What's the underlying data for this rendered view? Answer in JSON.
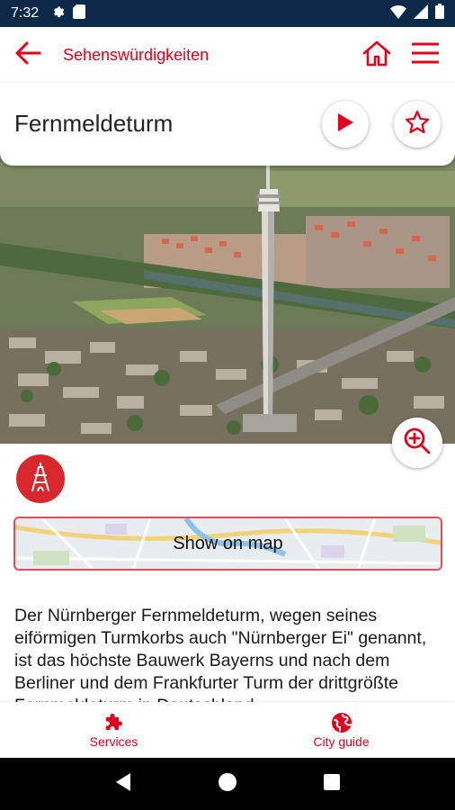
{
  "status_bar": {
    "time": "7:32",
    "left_icons": [
      "gear-icon",
      "sim-card-icon"
    ],
    "right_icons": [
      "wifi-icon",
      "signal-icon",
      "battery-icon"
    ]
  },
  "app_bar": {
    "title": "Sehenswürdigkeiten",
    "back_icon": "arrow-left-icon",
    "home_icon": "home-icon",
    "menu_icon": "hamburger-menu-icon",
    "accent_color": "#e2001a"
  },
  "place": {
    "title": "Fernmeldeturm",
    "photo_alt": "Aerial photo of the Nürnberger Fernmeldeturm",
    "play_icon": "play-icon",
    "favorite_icon": "star-outline-icon",
    "zoom_icon": "zoom-in-icon",
    "category_icon": "eiffel-tower-icon",
    "category_color": "#d9272e"
  },
  "map_button": {
    "label": "Show on map"
  },
  "description": {
    "text": "Der Nürnberger Fernmeldeturm, wegen seines eiförmigen Turmkorbs auch \"Nürnberger Ei\" genannt, ist das höchste Bauwerk Bayerns und nach dem Berliner und dem Frankfurter Turm der drittgrößte Fernmeldeturm in Deutschland."
  },
  "bottom_nav": {
    "items": [
      {
        "label": "Services",
        "icon": "puzzle-icon"
      },
      {
        "label": "City guide",
        "icon": "globe-icon"
      }
    ]
  },
  "system_nav": {
    "icons": [
      "back-triangle-icon",
      "home-circle-icon",
      "recents-square-icon"
    ]
  }
}
